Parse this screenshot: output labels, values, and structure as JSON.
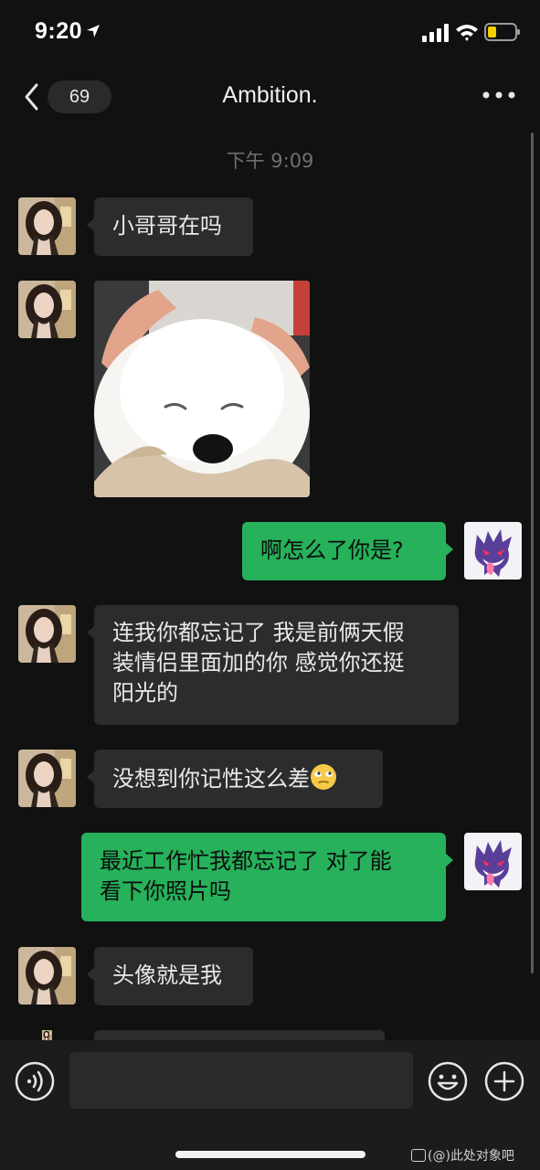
{
  "status_bar": {
    "time": "9:20"
  },
  "nav": {
    "unread_count": "69",
    "title": "Ambition."
  },
  "timestamp": "下午 9:09",
  "messages": [
    {
      "from": "them",
      "type": "text",
      "text": "小哥哥在吗"
    },
    {
      "from": "them",
      "type": "image",
      "icon": "samoyed-dog-photo"
    },
    {
      "from": "me",
      "type": "text",
      "text": "啊怎么了你是?"
    },
    {
      "from": "them",
      "type": "text",
      "lines": [
        "连我你都忘记了 我是前俩天假",
        "装情侣里面加的你 感觉你还挺",
        "阳光的"
      ]
    },
    {
      "from": "them",
      "type": "text",
      "text": "没想到你记性这么差",
      "emoji": "eye-roll-emoji"
    },
    {
      "from": "me",
      "type": "text",
      "lines": [
        "最近工作忙我都忘记了 对了能",
        "看下你照片吗"
      ]
    },
    {
      "from": "them",
      "type": "text",
      "text": "头像就是我"
    }
  ],
  "input_bar": {
    "value": "",
    "placeholder": ""
  },
  "watermark": "(@)此处对象吧",
  "colors": {
    "background": "#111111",
    "incoming_bubble": "#2c2c2c",
    "outgoing_bubble": "#26b15a"
  }
}
